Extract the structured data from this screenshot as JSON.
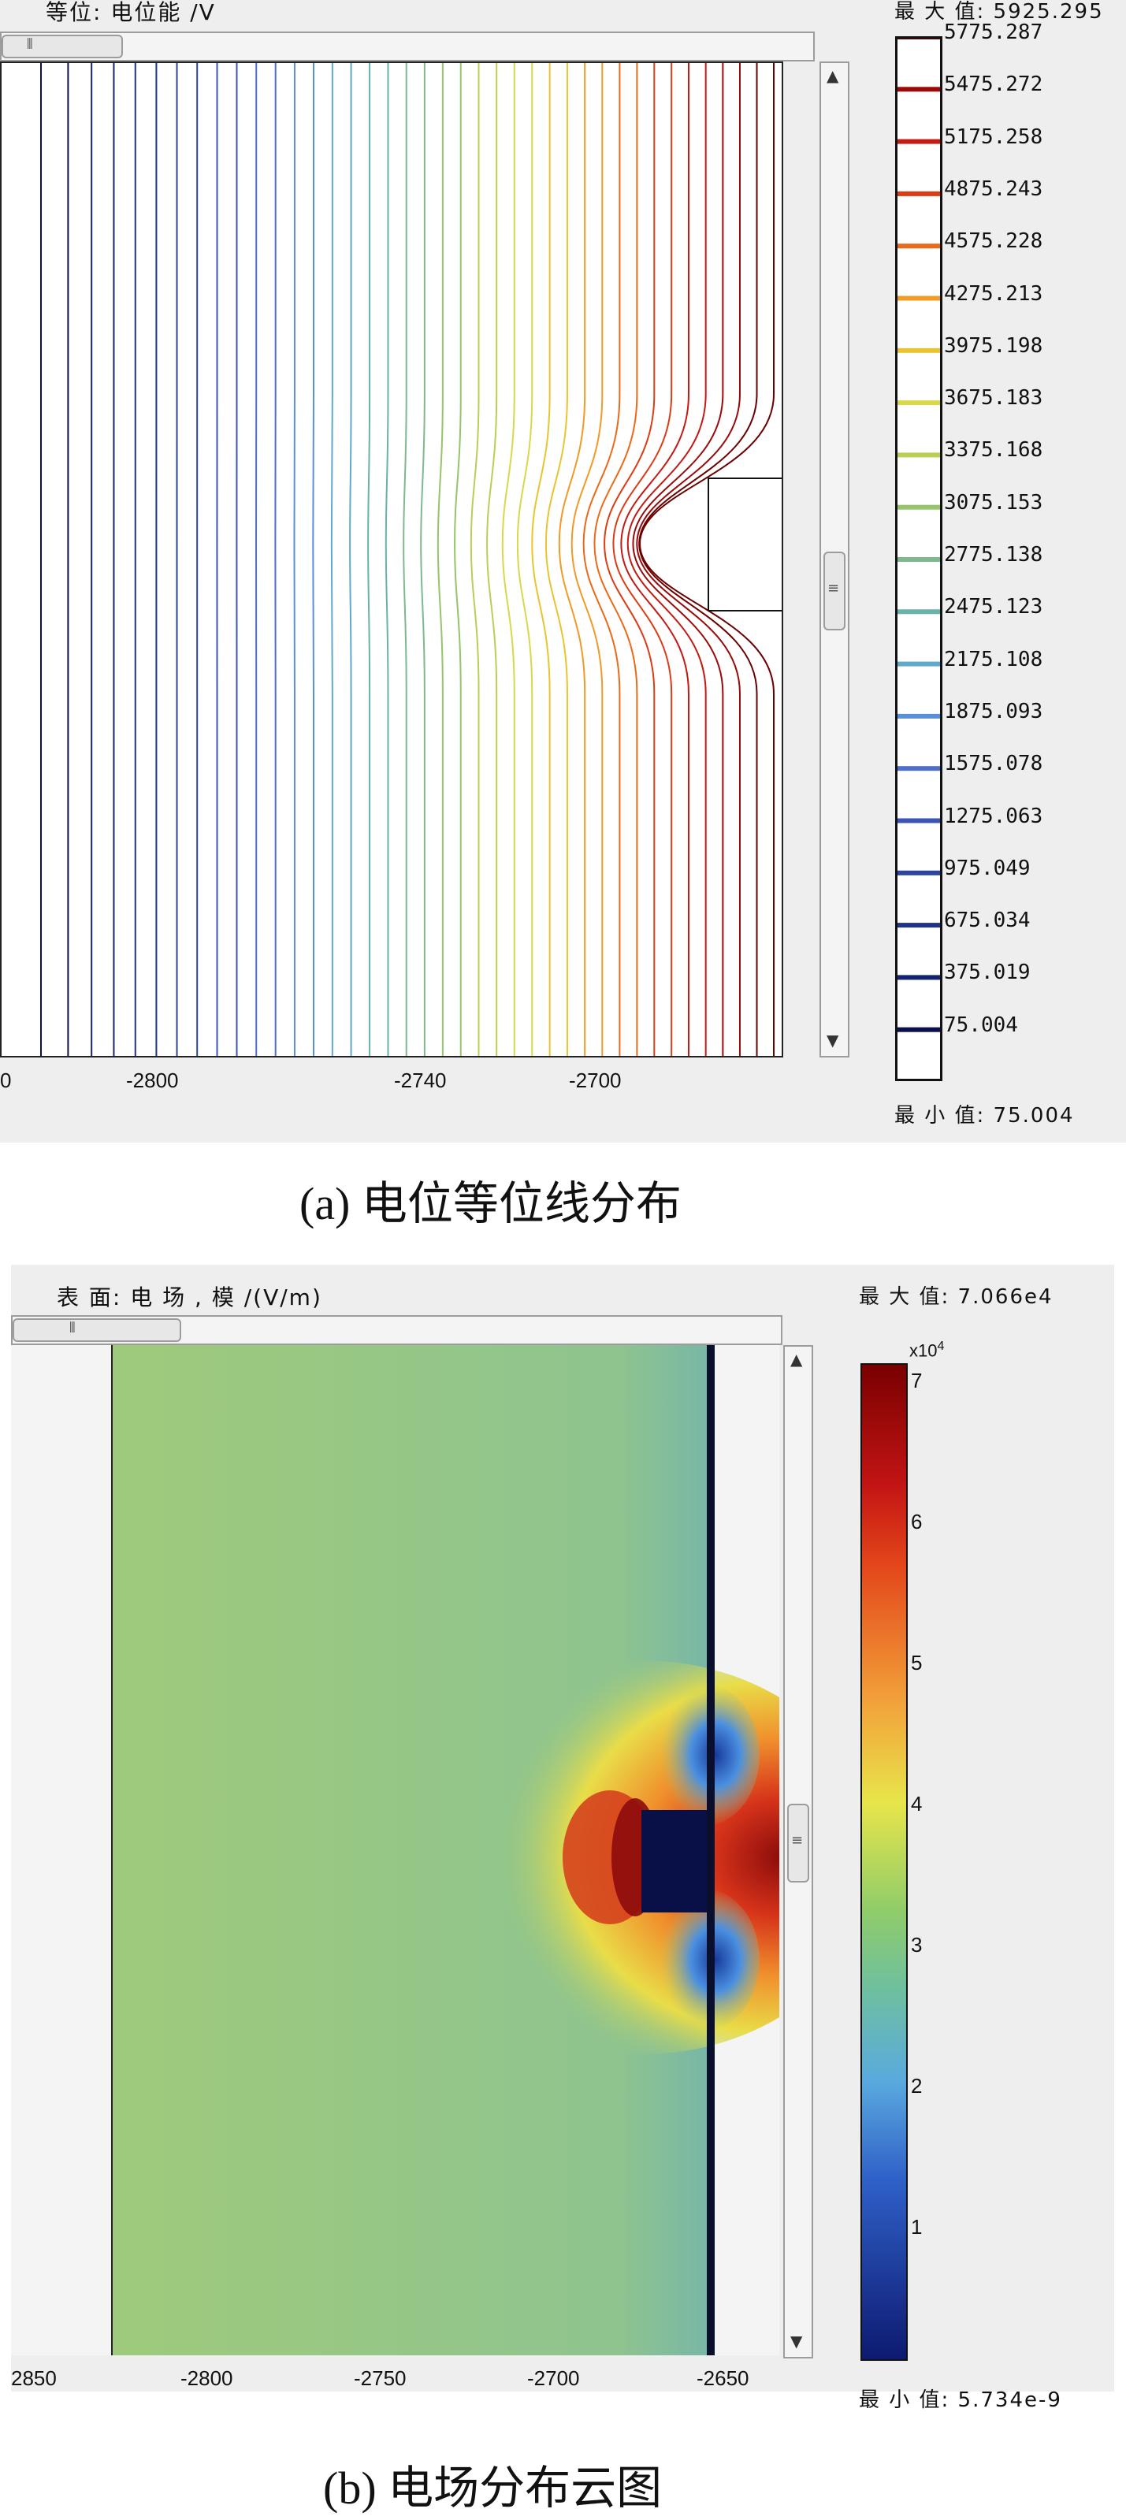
{
  "panel_a": {
    "title": "等位: 电位能 /V",
    "max_label": "最 大 值: 5925.295",
    "min_label": "最 小 值: 75.004",
    "x_ticks": [
      "0",
      "-2800",
      "-2740",
      "-2700"
    ],
    "legend_values": [
      "5775.287",
      "5475.272",
      "5175.258",
      "4875.243",
      "4575.228",
      "4275.213",
      "3975.198",
      "3675.183",
      "3375.168",
      "3075.153",
      "2775.138",
      "2475.123",
      "2175.108",
      "1875.093",
      "1575.078",
      "1275.063",
      "975.049",
      "675.034",
      "375.019",
      "75.004"
    ],
    "legend_colors": [
      "#6b0000",
      "#9a0a0a",
      "#c41a14",
      "#db3c15",
      "#ea6a1a",
      "#f19a25",
      "#e9c42e",
      "#d8d84a",
      "#b9cf53",
      "#97c36a",
      "#7fb88c",
      "#67b3aa",
      "#5fa9cc",
      "#5b8fd8",
      "#4f6fc6",
      "#3a55b3",
      "#2b449f",
      "#1f338a",
      "#142273",
      "#0b0f4e"
    ],
    "caption": "(a) 电位等位线分布"
  },
  "panel_b": {
    "title": "表 面: 电 场 , 模 /(V/m)",
    "max_label": "最 大 值: 7.066e4",
    "min_label": "最 小 值: 5.734e-9",
    "scale_multiplier": "x10",
    "scale_exponent": "4",
    "colorbar_ticks": [
      "7",
      "6",
      "5",
      "4",
      "3",
      "2",
      "1"
    ],
    "x_ticks": [
      "2850",
      "-2800",
      "-2750",
      "-2700",
      "-2650"
    ],
    "caption": "(b) 电场分布云图"
  }
}
